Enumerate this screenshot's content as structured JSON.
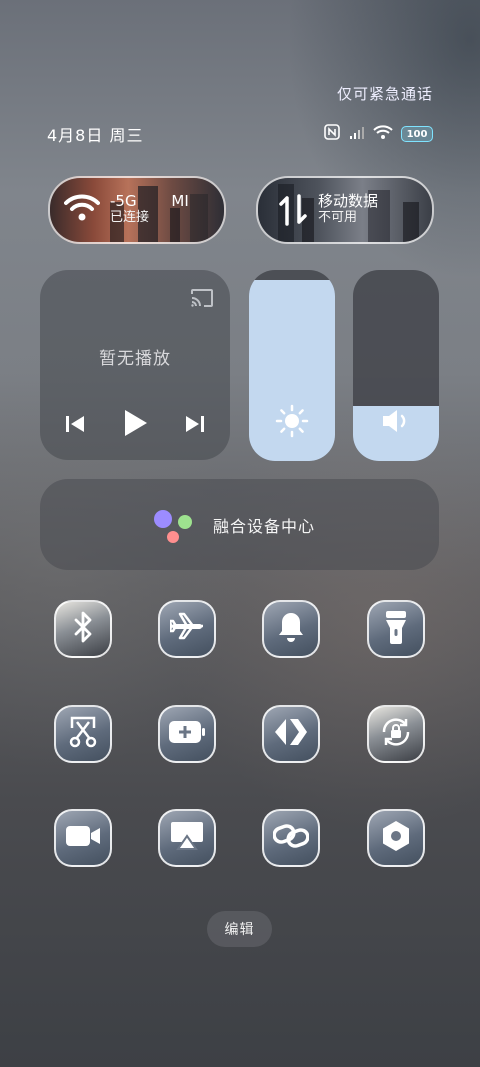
{
  "status": {
    "emergency_text": "仅可紧急通话",
    "date_text": "4月8日 周三",
    "battery_level": "100"
  },
  "connectivity": {
    "wifi": {
      "name": "-5G",
      "name_suffix": "MI",
      "status": "已连接"
    },
    "mobile_data": {
      "name": "移动数据",
      "status": "不可用"
    }
  },
  "media": {
    "title": "暂无播放"
  },
  "sliders": {
    "brightness": {
      "level_fraction": 0.95
    },
    "volume": {
      "level_fraction": 0.29
    }
  },
  "fusion_center": {
    "label": "融合设备中心"
  },
  "toggles": [
    {
      "name": "bluetooth-icon"
    },
    {
      "name": "airplane-icon"
    },
    {
      "name": "bell-icon"
    },
    {
      "name": "flashlight-icon"
    },
    {
      "name": "screenshot-icon"
    },
    {
      "name": "battery-saver-icon"
    },
    {
      "name": "dataflow-icon"
    },
    {
      "name": "rotation-lock-icon"
    },
    {
      "name": "screen-record-icon"
    },
    {
      "name": "screencast-icon"
    },
    {
      "name": "link-icon"
    },
    {
      "name": "settings-icon"
    }
  ],
  "edit_button": {
    "label": "编辑"
  },
  "colors": {
    "slider_fill": "#c3d8ef",
    "battery_accent": "#7fe3ff"
  }
}
